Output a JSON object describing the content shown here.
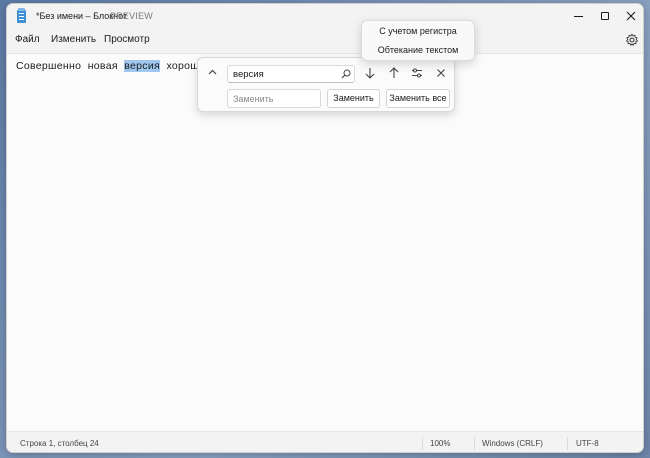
{
  "window": {
    "title": "*Без имени – Блокнот",
    "badge": "PREVIEW",
    "accent": "#3d8fd6"
  },
  "menu": {
    "file": "Файл",
    "edit": "Изменить",
    "view": "Просмотр"
  },
  "editor": {
    "text_before": "Совершенно  новая  ",
    "text_selected": "версия",
    "text_after": "  хорошо",
    "selection_color": "#9fc7ef"
  },
  "find": {
    "search_value": "версия",
    "replace_placeholder": "Заменить",
    "replace_button": "Заменить",
    "replace_all_button": "Заменить все"
  },
  "options_menu": {
    "items": [
      {
        "label": "С учетом регистра"
      },
      {
        "label": "Обтекание текстом"
      }
    ]
  },
  "status": {
    "position": "Строка 1, столбец 24",
    "zoom": "100%",
    "line_ending": "Windows (CRLF)",
    "encoding": "UTF-8"
  },
  "icons": [
    "notepad-icon",
    "minimize-icon",
    "maximize-icon",
    "close-icon",
    "gear-icon",
    "chevron-up-icon",
    "search-icon",
    "arrow-down-icon",
    "arrow-up-icon",
    "options-icon",
    "close-find-icon"
  ]
}
